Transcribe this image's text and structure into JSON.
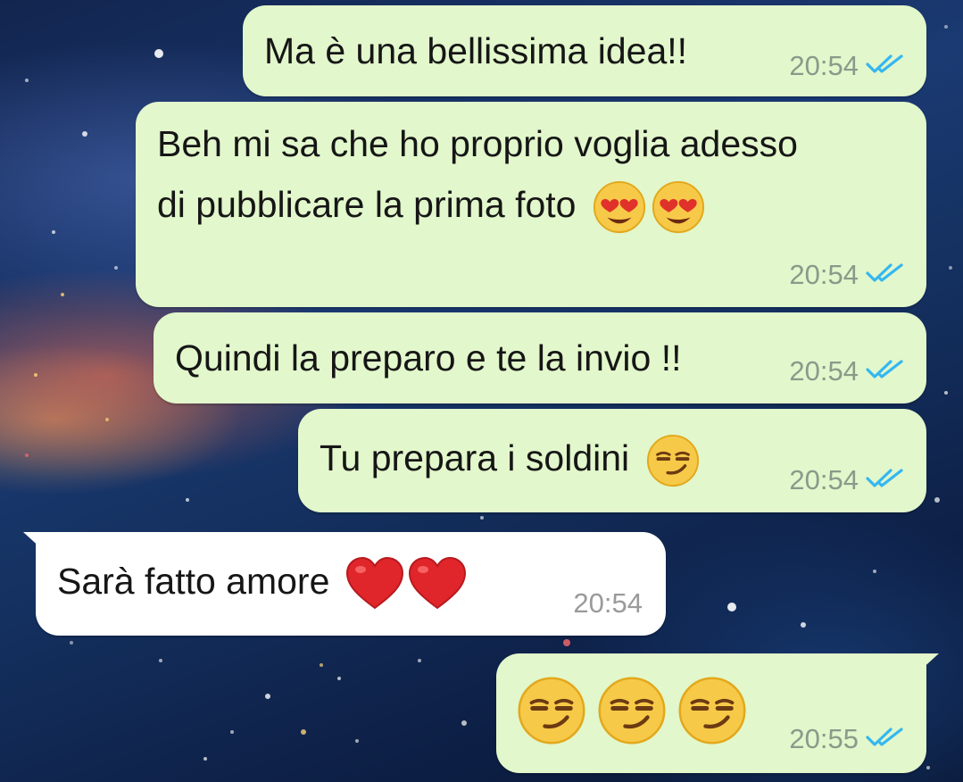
{
  "chat": {
    "messages": [
      {
        "direction": "outgoing",
        "text": "Ma è una bellissima idea!!",
        "time": "20:54",
        "status": "read-double-check"
      },
      {
        "direction": "outgoing",
        "lines": [
          "Beh mi sa che ho proprio voglia adesso",
          "di pubblicare la prima foto"
        ],
        "emojis": [
          "heart-eyes-emoji",
          "heart-eyes-emoji"
        ],
        "time": "20:54",
        "status": "read-double-check"
      },
      {
        "direction": "outgoing",
        "text": "Quindi la preparo e te la invio !!",
        "time": "20:54",
        "status": "read-double-check"
      },
      {
        "direction": "outgoing",
        "text": "Tu prepara i soldini",
        "emojis": [
          "smirk-emoji"
        ],
        "time": "20:54",
        "status": "read-double-check"
      },
      {
        "direction": "incoming",
        "text": "Sarà fatto amore",
        "emojis": [
          "red-heart-emoji",
          "red-heart-emoji"
        ],
        "time": "20:54"
      },
      {
        "direction": "outgoing",
        "emojis": [
          "smirk-emoji",
          "smirk-emoji",
          "smirk-emoji"
        ],
        "time": "20:55",
        "status": "read-double-check"
      }
    ]
  },
  "colors": {
    "outgoing_bubble": "#e2f7cb",
    "incoming_bubble": "#ffffff",
    "read_check": "#34b7f1",
    "timestamp": "#8a9a8a"
  }
}
